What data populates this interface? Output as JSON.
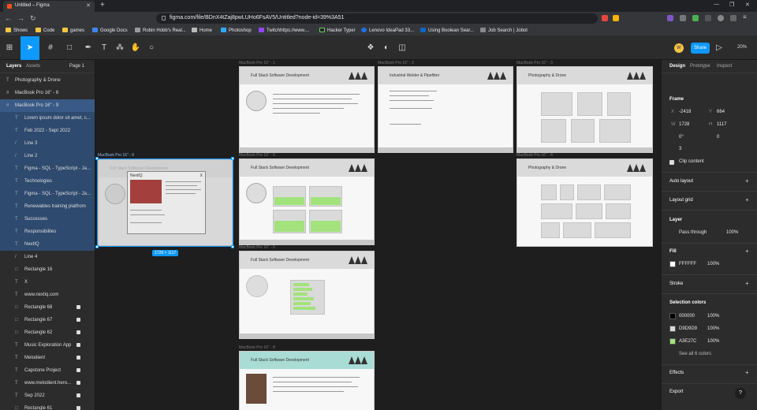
{
  "browser": {
    "tab_title": "Untitled – Figma",
    "new_tab": "+",
    "url": "figma.com/file/BDnX4tZaj8pwLUHo6FsAV5/Untitled?node-id=39%3A51",
    "bookmarks": [
      "Shows",
      "Code",
      "games",
      "Google Docs",
      "Robin Hobb's Real...",
      "Home",
      "Photoshop",
      "Twitchhttps://www....",
      "Hacker Typer",
      "Lenovo IdeaPad 33...",
      "Using Boolean Sear...",
      "Job Search | Jobot"
    ]
  },
  "toolbar": {
    "avatar_initial": "W",
    "share_label": "Share",
    "zoom": "20%"
  },
  "left_panel": {
    "tabs": [
      "Layers",
      "Assets"
    ],
    "page": "Page 1",
    "layers": [
      {
        "icon": "T",
        "name": "Photography & Drone",
        "lock": false
      },
      {
        "icon": "#",
        "name": "MacBook Pro 16\" - 6",
        "lock": false
      },
      {
        "icon": "#",
        "name": "MacBook Pro 16\" - 9",
        "lock": false
      },
      {
        "icon": "T",
        "name": "Lorem ipsum dolor sit amet, c...",
        "lock": false
      },
      {
        "icon": "T",
        "name": "Feb 2022 - Sept 2022",
        "lock": false
      },
      {
        "icon": "/",
        "name": "Line 3",
        "lock": false
      },
      {
        "icon": "/",
        "name": "Line 2",
        "lock": false
      },
      {
        "icon": "T",
        "name": "Figma - SQL - TypeScript - Ja...",
        "lock": false
      },
      {
        "icon": "T",
        "name": "Technologies",
        "lock": false
      },
      {
        "icon": "T",
        "name": "Figma - SQL - TypeScript - Ja...",
        "lock": false
      },
      {
        "icon": "T",
        "name": "Renewables training platfrom",
        "lock": false
      },
      {
        "icon": "T",
        "name": "Successes",
        "lock": false
      },
      {
        "icon": "T",
        "name": "Responsibilites",
        "lock": false
      },
      {
        "icon": "T",
        "name": "NextIQ",
        "lock": false
      },
      {
        "icon": "/",
        "name": "Line 4",
        "lock": false
      },
      {
        "icon": "□",
        "name": "Rectangle 16",
        "lock": false
      },
      {
        "icon": "T",
        "name": "X",
        "lock": false
      },
      {
        "icon": "T",
        "name": "www.nextiq.com",
        "lock": false
      },
      {
        "icon": "□",
        "name": "Rectangle 68",
        "lock": true
      },
      {
        "icon": "□",
        "name": "Rectangle 67",
        "lock": true
      },
      {
        "icon": "□",
        "name": "Rectangle 62",
        "lock": true
      },
      {
        "icon": "T",
        "name": "Music Exploration App",
        "lock": true
      },
      {
        "icon": "T",
        "name": "Melodient",
        "lock": true
      },
      {
        "icon": "T",
        "name": "Capstone Project",
        "lock": true
      },
      {
        "icon": "T",
        "name": "www.melodient.hero...",
        "lock": true
      },
      {
        "icon": "T",
        "name": "Sep 2022",
        "lock": true
      },
      {
        "icon": "□",
        "name": "Rectangle 61",
        "lock": true
      }
    ]
  },
  "canvas": {
    "frames": [
      {
        "label": "MacBook Pro 16\" - 1",
        "title": "Full Stack Software Development"
      },
      {
        "label": "MacBook Pro 16\" - 2",
        "title": "Industrial Welder & Pipefitter"
      },
      {
        "label": "MacBook Pro 16\" - 3",
        "title": "Photography & Drone"
      },
      {
        "label": "MacBook Pro 16\" - 5",
        "title": "Full Stack Software Development"
      },
      {
        "label": "MacBook Pro 16\" - 4",
        "title": "Photography & Drone"
      },
      {
        "label": "MacBook Pro 16\" - 6",
        "title": "Full Stack Software Development"
      },
      {
        "label": "MacBook Pro 16\" - 8",
        "title": "Full Stack Software Development"
      },
      {
        "label": "MacBook Pro 16\" - 9",
        "title": "Full Stack Software Development"
      }
    ],
    "selected_dims": "1728 × 1117",
    "selected_card_title": "NextIQ",
    "selected_close": "X"
  },
  "right_panel": {
    "tabs": [
      "Design",
      "Prototype",
      "Inspect"
    ],
    "frame_label": "Frame",
    "x_label": "X",
    "x": "-2418",
    "y_label": "Y",
    "y": "664",
    "w_label": "W",
    "w": "1728",
    "h_label": "H",
    "h": "1117",
    "rotation": "0°",
    "corner": "0",
    "independent": "3",
    "clip_content": "Clip content",
    "auto_layout": "Auto layout",
    "layout_grid": "Layout grid",
    "layer": "Layer",
    "blend": "Pass through",
    "layer_opacity": "100%",
    "fill": "Fill",
    "fill_hex": "FFFFFF",
    "fill_opacity": "100%",
    "stroke": "Stroke",
    "selection_colors": "Selection colors",
    "colors": [
      {
        "hex": "000000",
        "pct": "100%",
        "swatch": "#000000"
      },
      {
        "hex": "D9D9D9",
        "pct": "100%",
        "swatch": "#D9D9D9"
      },
      {
        "hex": "A3E27C",
        "pct": "100%",
        "swatch": "#A3E27C"
      }
    ],
    "see_all": "See all 6 colors",
    "effects": "Effects",
    "export": "Export",
    "help": "?"
  }
}
